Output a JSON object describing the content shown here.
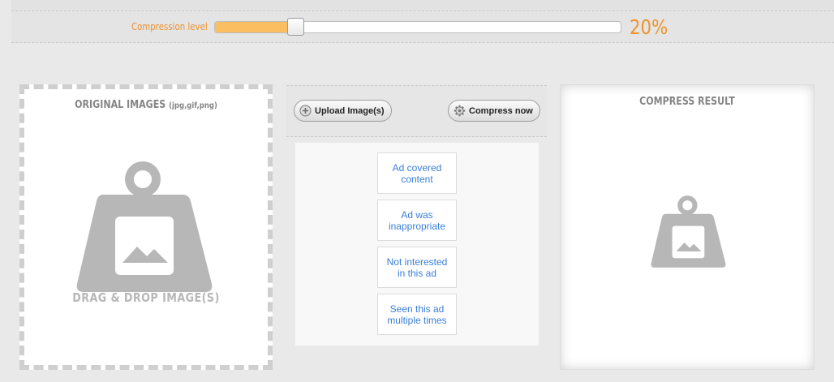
{
  "slider": {
    "label": "Compression level",
    "value_text": "20%",
    "value": 20,
    "fill_color": "#fbbf62"
  },
  "original_panel": {
    "title": "ORIGINAL IMAGES",
    "subtitle": "(jpg,gif,png)",
    "dropzone_text": "DRAG & DROP IMAGE(S)",
    "icon": "weight-image-icon"
  },
  "toolbar": {
    "upload_label": "Upload Image(s)",
    "compress_label": "Compress now",
    "upload_icon": "plus-circle-icon",
    "compress_icon": "gear-icon"
  },
  "ad_feedback": {
    "options": [
      "Ad covered content",
      "Ad was inappropriate",
      "Not interested in this ad",
      "Seen this ad multiple times"
    ]
  },
  "result_panel": {
    "title": "COMPRESS RESULT",
    "icon": "weight-image-icon"
  },
  "colors": {
    "accent": "#f0922c",
    "link": "#3a7ed8",
    "icon_gray": "#b7b7b7"
  }
}
